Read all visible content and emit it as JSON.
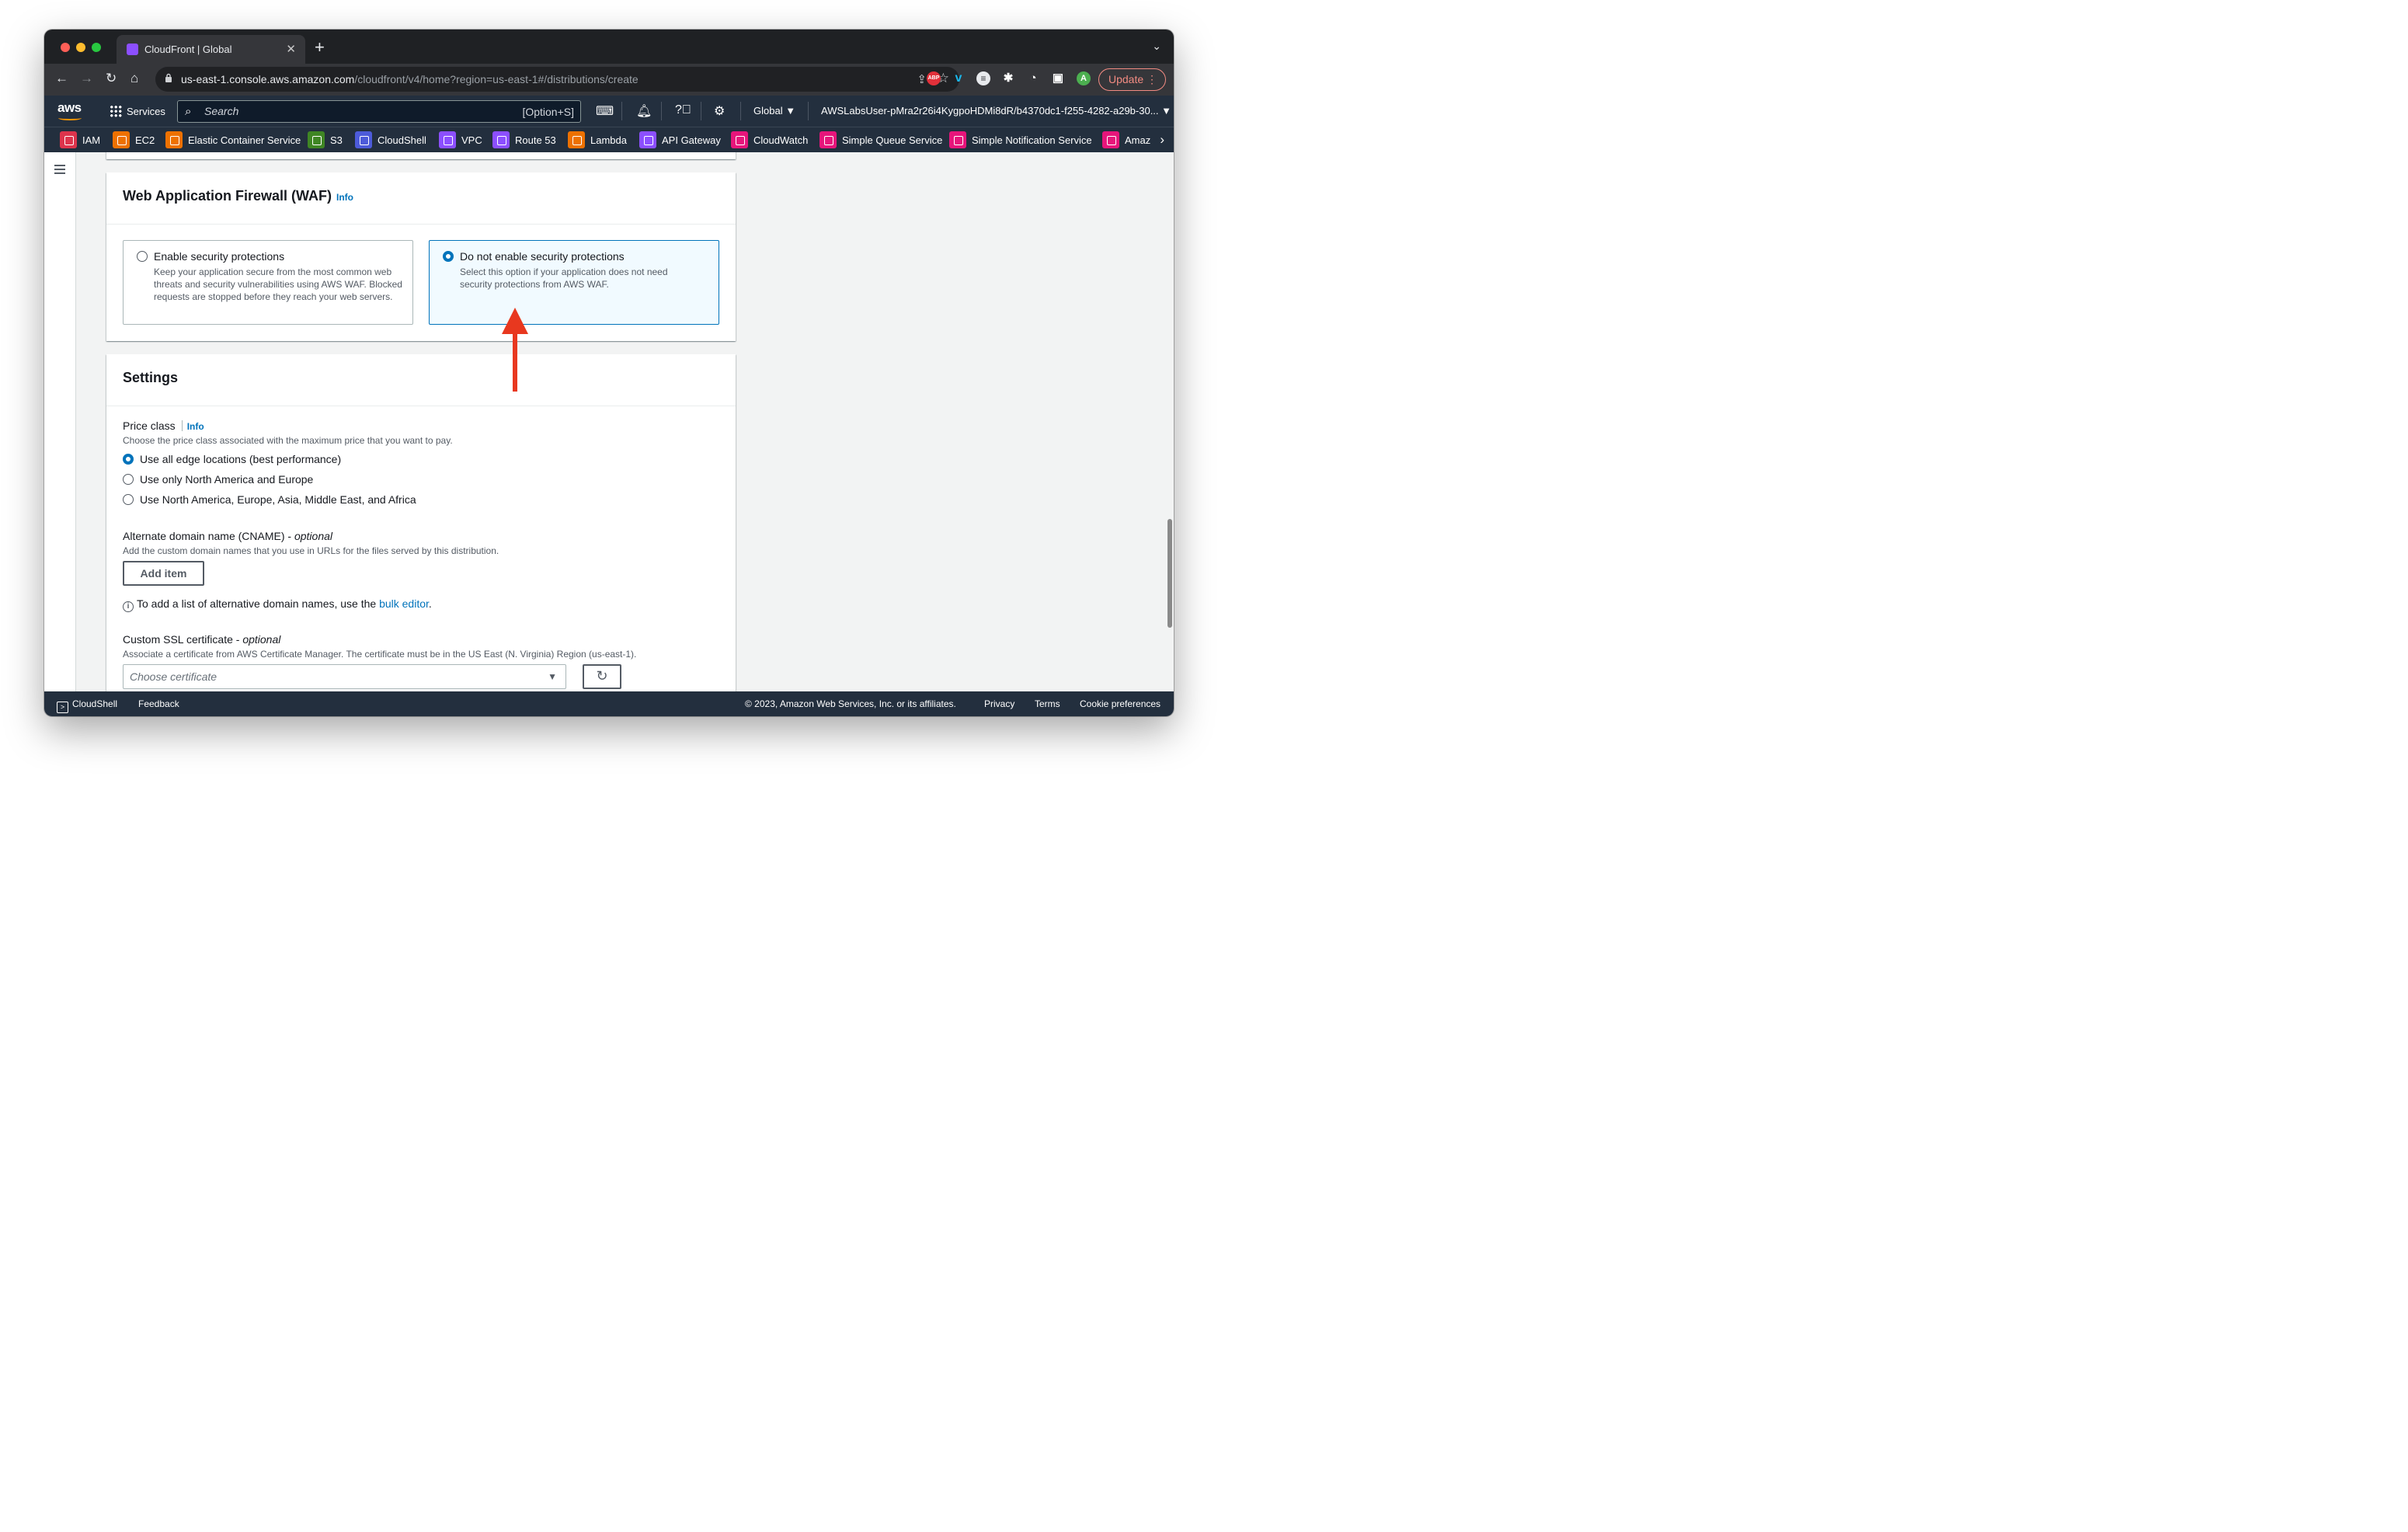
{
  "browser": {
    "tab_title": "CloudFront | Global",
    "url_host": "us-east-1.console.aws.amazon.com",
    "url_path": "/cloudfront/v4/home?region=us-east-1#/distributions/create",
    "update_label": "Update",
    "extensions": [
      {
        "name": "abp",
        "label": "ABP",
        "color": "#e2303a"
      },
      {
        "name": "vimeo",
        "label": "v",
        "color": "#1ab7ea"
      },
      {
        "name": "profile",
        "label": "A",
        "color": "#4caf50"
      }
    ]
  },
  "aws_nav": {
    "logo": "aws",
    "services_label": "Services",
    "search_placeholder": "Search",
    "search_shortcut": "[Option+S]",
    "region": "Global ▼",
    "account": "AWSLabsUser-pMra2r26i4KygpoHDMi8dR/b4370dc1-f255-4282-a29b-30... ▼"
  },
  "favorites": [
    {
      "label": "IAM",
      "color": "#dd344c"
    },
    {
      "label": "EC2",
      "color": "#ed7100"
    },
    {
      "label": "Elastic Container Service",
      "color": "#ed7100"
    },
    {
      "label": "S3",
      "color": "#3f8624"
    },
    {
      "label": "CloudShell",
      "color": "#4d5bd9"
    },
    {
      "label": "VPC",
      "color": "#8c4fff"
    },
    {
      "label": "Route 53",
      "color": "#8c4fff"
    },
    {
      "label": "Lambda",
      "color": "#ed7100"
    },
    {
      "label": "API Gateway",
      "color": "#8c4fff"
    },
    {
      "label": "CloudWatch",
      "color": "#e7157b"
    },
    {
      "label": "Simple Queue Service",
      "color": "#e7157b"
    },
    {
      "label": "Simple Notification Service",
      "color": "#e7157b"
    },
    {
      "label": "Amazo",
      "color": "#e7157b"
    }
  ],
  "waf": {
    "title": "Web Application Firewall (WAF)",
    "info": "Info",
    "options": [
      {
        "title": "Enable security protections",
        "description": "Keep your application secure from the most common web threats and security vulnerabilities using AWS WAF. Blocked requests are stopped before they reach your web servers.",
        "selected": false
      },
      {
        "title": "Do not enable security protections",
        "description": "Select this option if your application does not need security protections from AWS WAF.",
        "selected": true
      }
    ]
  },
  "settings": {
    "title": "Settings",
    "price_class": {
      "label": "Price class",
      "info": "Info",
      "description": "Choose the price class associated with the maximum price that you want to pay.",
      "options": [
        {
          "label": "Use all edge locations (best performance)",
          "selected": true
        },
        {
          "label": "Use only North America and Europe",
          "selected": false
        },
        {
          "label": "Use North America, Europe, Asia, Middle East, and Africa",
          "selected": false
        }
      ]
    },
    "cname": {
      "label": "Alternate domain name (CNAME) - ",
      "optional": "optional",
      "description": "Add the custom domain names that you use in URLs for the files served by this distribution.",
      "add_item": "Add item",
      "hint_prefix": "To add a list of alternative domain names, use the ",
      "hint_link": "bulk editor",
      "hint_suffix": "."
    },
    "ssl": {
      "label": "Custom SSL certificate - ",
      "optional": "optional",
      "description": "Associate a certificate from AWS Certificate Manager. The certificate must be in the US East (N. Virginia) Region (us-east-1).",
      "placeholder": "Choose certificate"
    }
  },
  "footer": {
    "cloudshell": "CloudShell",
    "feedback": "Feedback",
    "copyright": "© 2023, Amazon Web Services, Inc. or its affiliates.",
    "privacy": "Privacy",
    "terms": "Terms",
    "cookies": "Cookie preferences"
  },
  "colors": {
    "aws_nav": "#232f3e",
    "link": "#0073bb",
    "annotation_arrow": "#e8381f"
  }
}
